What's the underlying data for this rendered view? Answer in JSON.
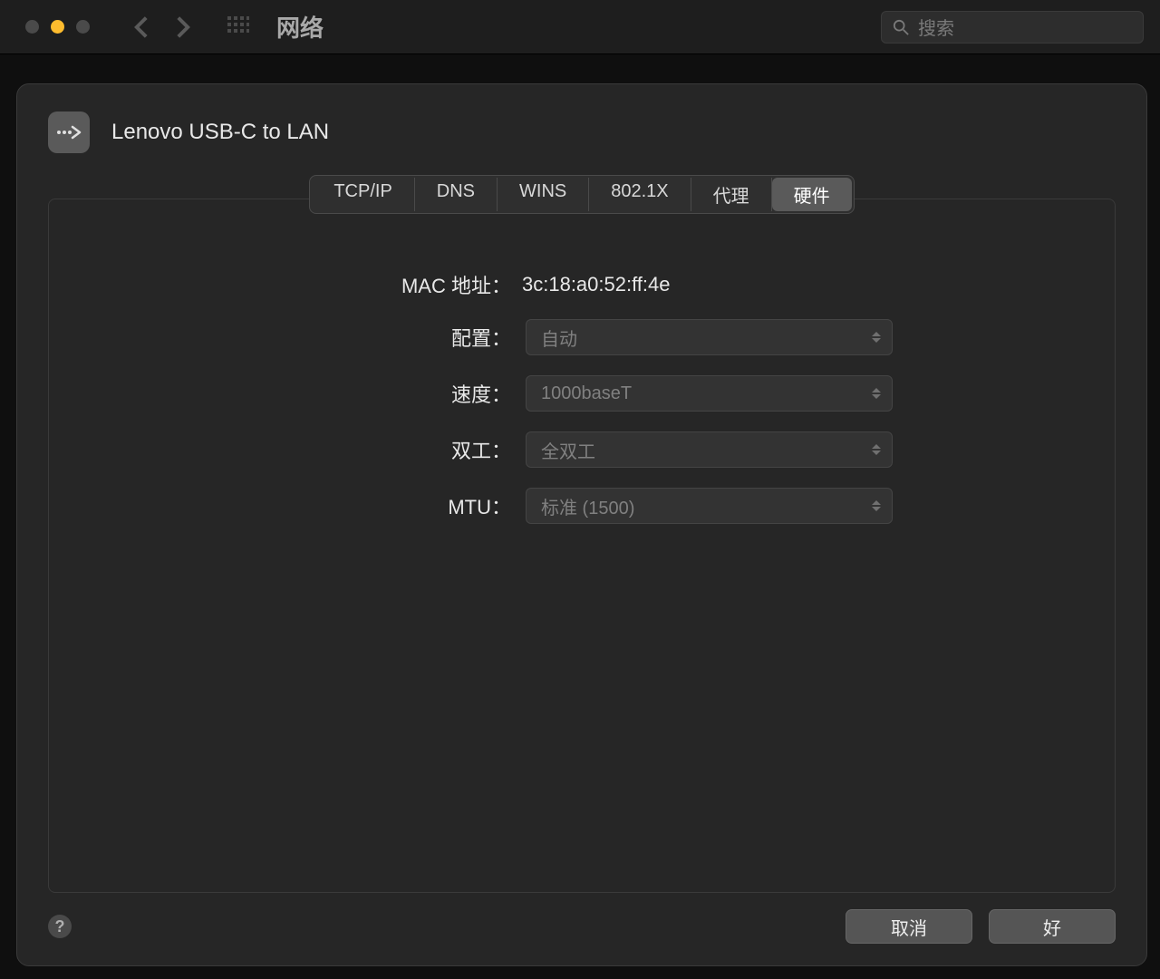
{
  "window": {
    "title": "网络",
    "search_placeholder": "搜索"
  },
  "interface": {
    "name": "Lenovo USB-C to LAN"
  },
  "tabs": [
    {
      "label": "TCP/IP",
      "active": false
    },
    {
      "label": "DNS",
      "active": false
    },
    {
      "label": "WINS",
      "active": false
    },
    {
      "label": "802.1X",
      "active": false
    },
    {
      "label": "代理",
      "active": false
    },
    {
      "label": "硬件",
      "active": true
    }
  ],
  "hardware": {
    "mac_label": "MAC 地址：",
    "mac_value": "3c:18:a0:52:ff:4e",
    "config_label": "配置：",
    "config_value": "自动",
    "speed_label": "速度：",
    "speed_value": "1000baseT",
    "duplex_label": "双工：",
    "duplex_value": "全双工",
    "mtu_label": "MTU：",
    "mtu_value": "标准 (1500)"
  },
  "footer": {
    "help": "?",
    "cancel": "取消",
    "ok": "好"
  }
}
